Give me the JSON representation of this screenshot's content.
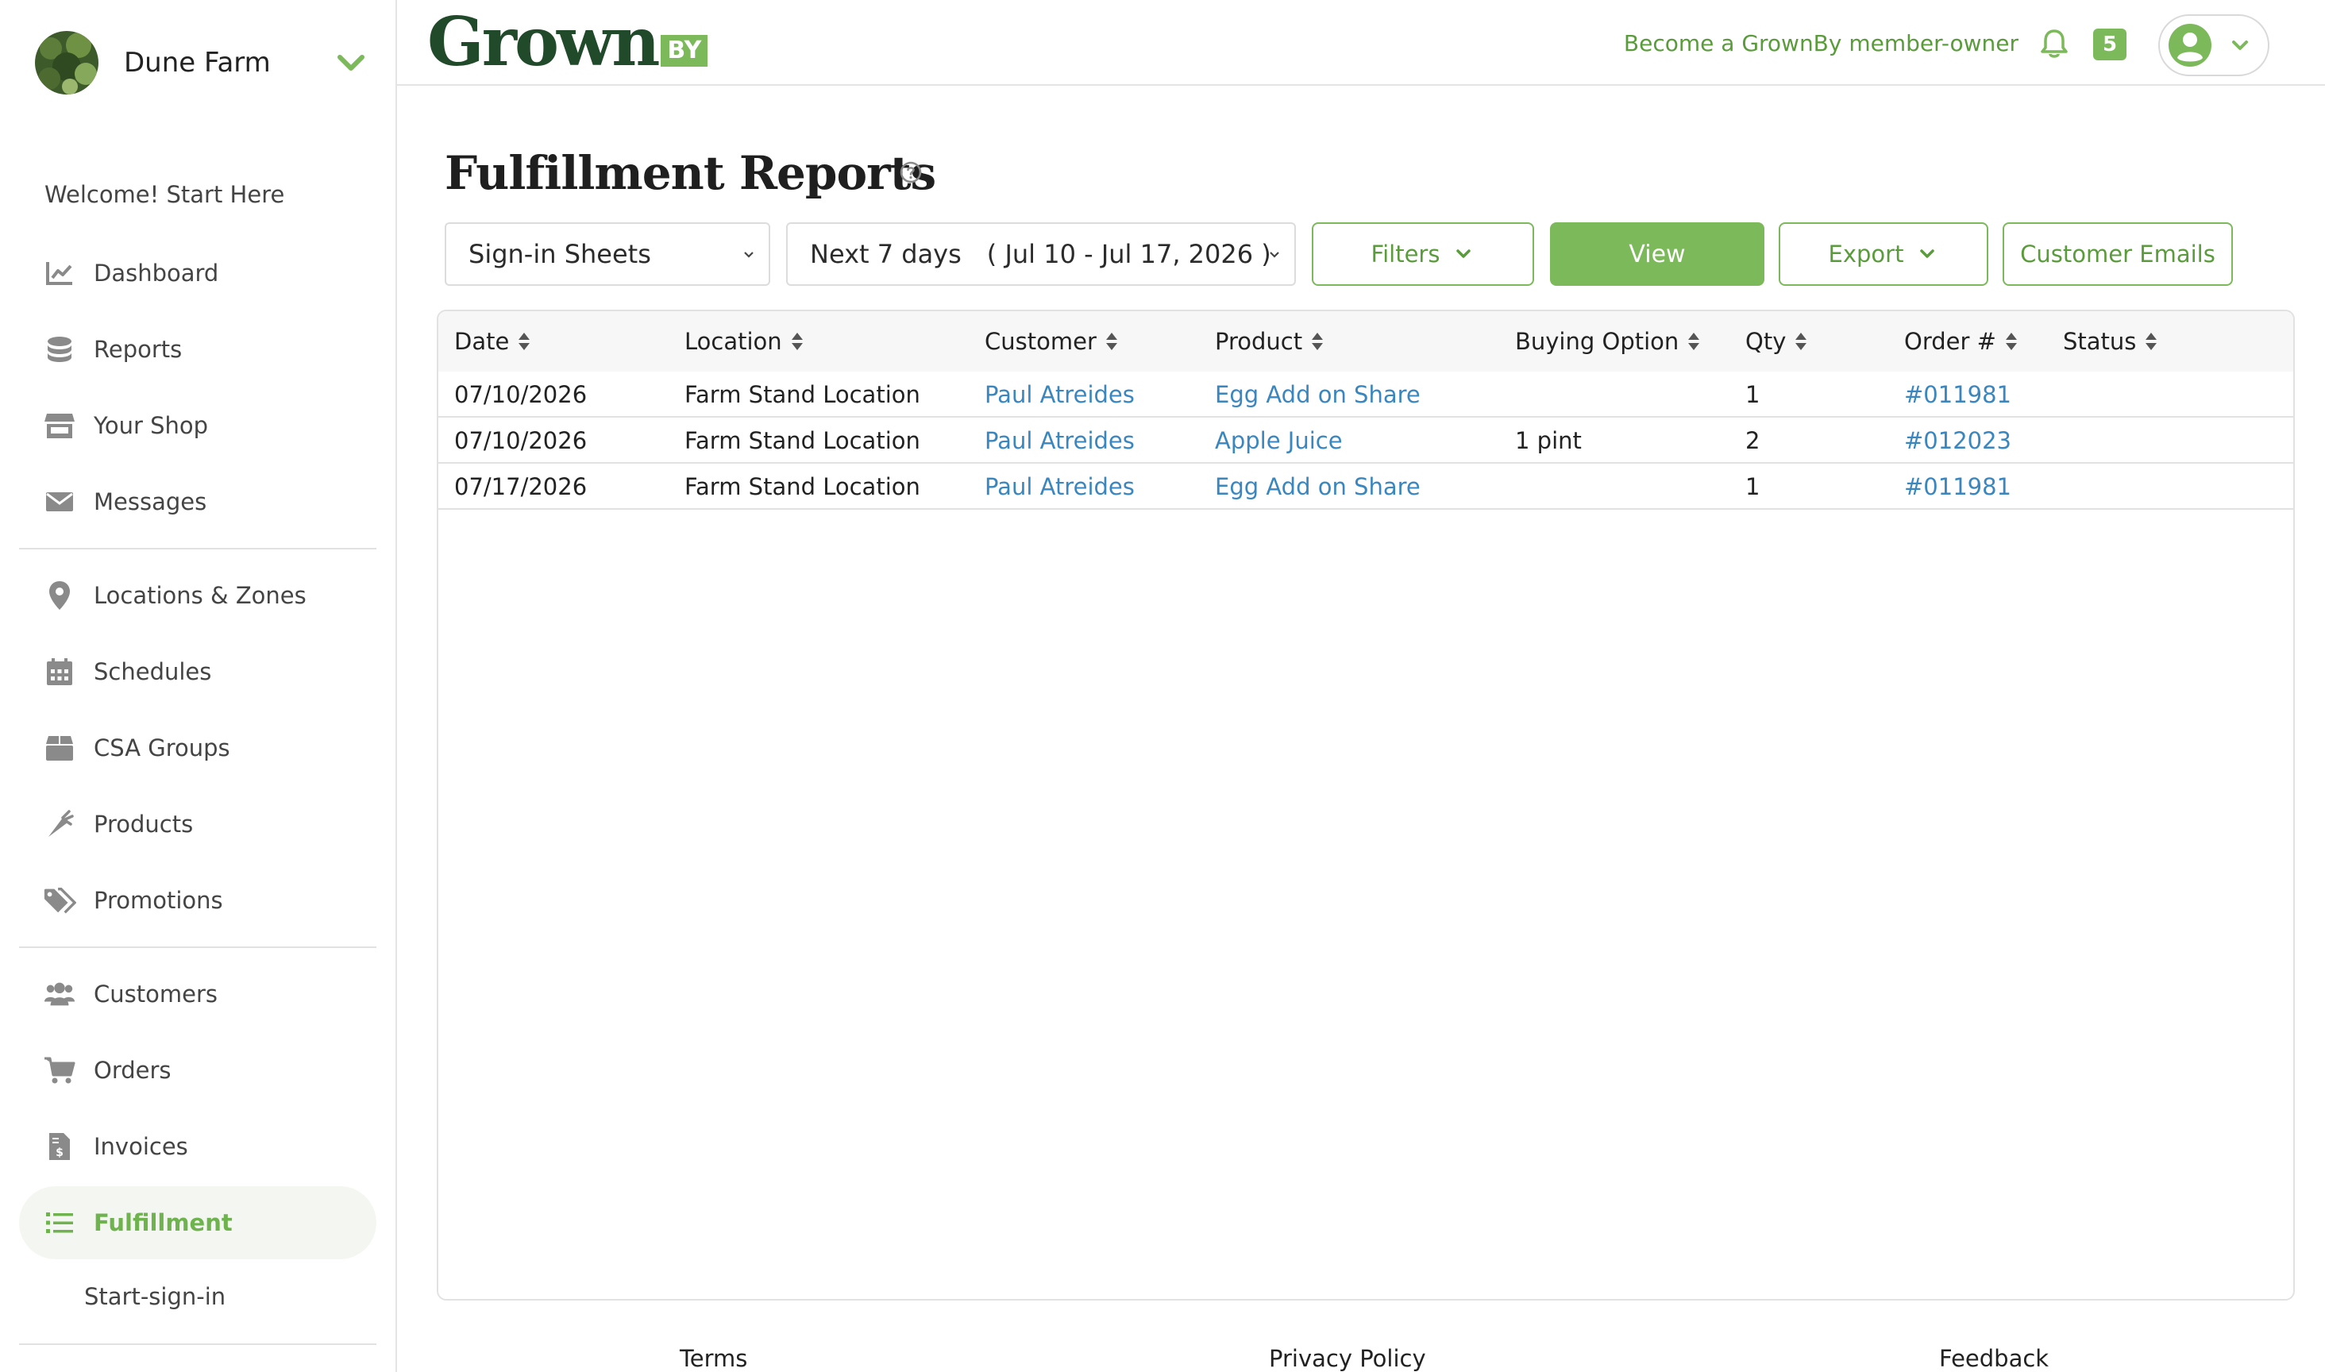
{
  "sidebar": {
    "farm_name": "Dune Farm",
    "welcome": "Welcome! Start Here",
    "items": [
      {
        "label": "Dashboard",
        "icon": "chart-line-icon"
      },
      {
        "label": "Reports",
        "icon": "coins-icon"
      },
      {
        "label": "Your Shop",
        "icon": "storefront-icon"
      },
      {
        "label": "Messages",
        "icon": "envelope-icon"
      },
      {
        "label": "Locations & Zones",
        "icon": "map-pin-icon"
      },
      {
        "label": "Schedules",
        "icon": "calendar-icon"
      },
      {
        "label": "CSA Groups",
        "icon": "box-icon"
      },
      {
        "label": "Products",
        "icon": "carrot-icon"
      },
      {
        "label": "Promotions",
        "icon": "tags-icon"
      },
      {
        "label": "Customers",
        "icon": "users-icon"
      },
      {
        "label": "Orders",
        "icon": "cart-icon"
      },
      {
        "label": "Invoices",
        "icon": "invoice-icon"
      },
      {
        "label": "Fulfillment",
        "icon": "list-icon",
        "active": true
      }
    ],
    "sub_item": "Start-sign-in"
  },
  "header": {
    "logo_main": "Grown",
    "logo_badge": "BY",
    "member_link": "Become a GrownBy member-owner",
    "notification_count": "5"
  },
  "main": {
    "title": "Fulfillment Reports",
    "report_type": "Sign-in Sheets",
    "date_range": "Next 7 days ( Jul 10 - Jul 17, 2026 )",
    "filters_label": "Filters",
    "view_label": "View",
    "export_label": "Export",
    "customer_emails_label": "Customer Emails"
  },
  "table": {
    "columns": [
      "Date",
      "Location",
      "Customer",
      "Product",
      "Buying Option",
      "Qty",
      "Order #",
      "Status"
    ],
    "rows": [
      {
        "date": "07/10/2026",
        "location": "Farm Stand Location",
        "customer": "Paul Atreides",
        "product": "Egg Add on Share",
        "buying_option": "",
        "qty": "1",
        "order": "#011981",
        "status": ""
      },
      {
        "date": "07/10/2026",
        "location": "Farm Stand Location",
        "customer": "Paul Atreides",
        "product": "Apple Juice",
        "buying_option": "1 pint",
        "qty": "2",
        "order": "#012023",
        "status": ""
      },
      {
        "date": "07/17/2026",
        "location": "Farm Stand Location",
        "customer": "Paul Atreides",
        "product": "Egg Add on Share",
        "buying_option": "",
        "qty": "1",
        "order": "#011981",
        "status": ""
      }
    ]
  },
  "footer": {
    "terms": "Terms",
    "privacy": "Privacy Policy",
    "feedback": "Feedback"
  },
  "colors": {
    "accent": "#7cb95b",
    "accent_text": "#5a9b3c",
    "link": "#3a86bf",
    "logo_dark": "#214a2a"
  }
}
